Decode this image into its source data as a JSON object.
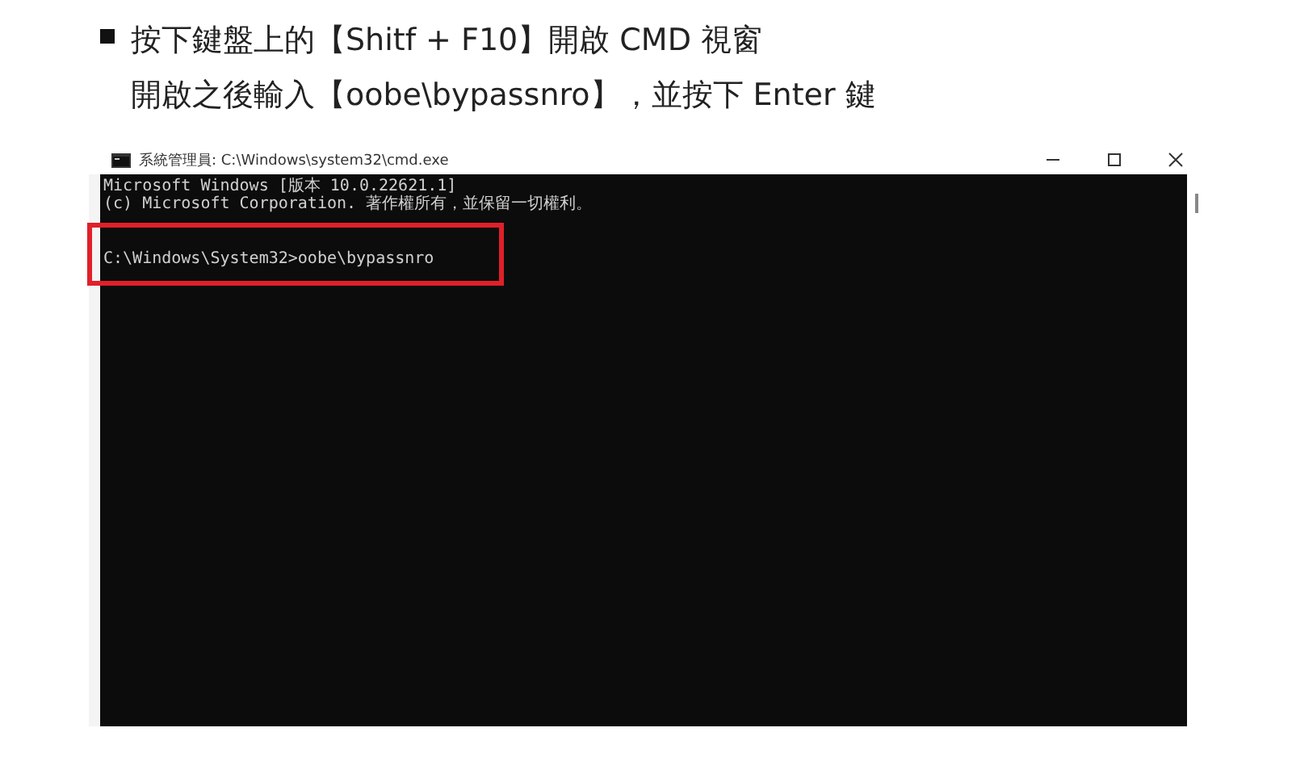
{
  "instruction": {
    "lines": [
      "按下鍵盤上的【Shitf + F10】開啟 CMD 視窗",
      "開啟之後輸入【oobe\\bypassnro】，並按下 Enter 鍵"
    ]
  },
  "window": {
    "title": "系統管理員: C:\\Windows\\system32\\cmd.exe",
    "console_lines": [
      {
        "text": "Microsoft Windows [版本 10.0.22621.1]",
        "highlighted": false
      },
      {
        "text": "(c) Microsoft Corporation. 著作權所有，並保留一切權利。",
        "highlighted": false
      },
      {
        "text": "C:\\Windows\\System32>oobe\\bypassnro",
        "highlighted": true
      }
    ]
  }
}
